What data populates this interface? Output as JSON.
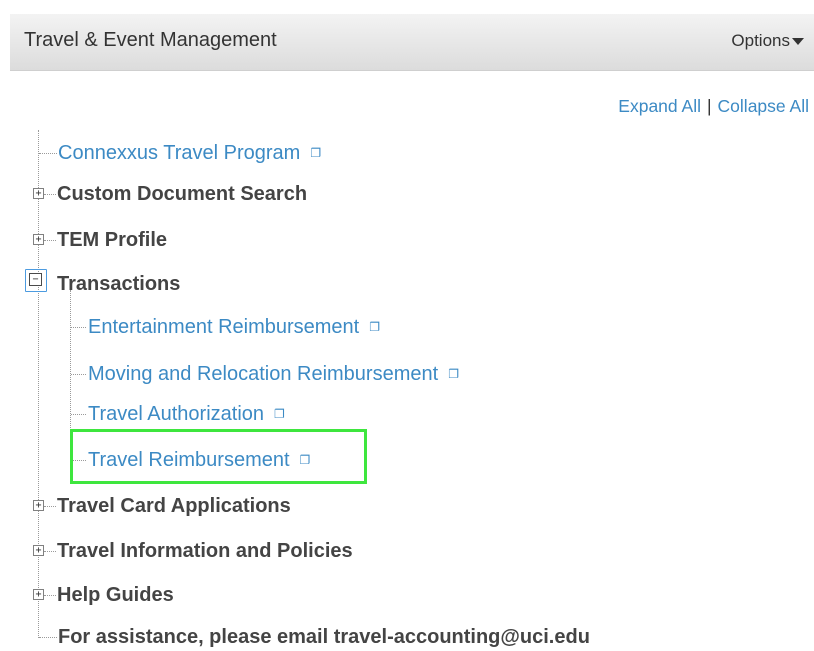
{
  "header": {
    "title": "Travel & Event Management",
    "options_label": "Options"
  },
  "expand_collapse": {
    "expand_label": "Expand All",
    "separator": "|",
    "collapse_label": "Collapse All"
  },
  "tree": {
    "connexxus": "Connexxus Travel Program",
    "custom_search": "Custom Document Search",
    "tem_profile": "TEM Profile",
    "transactions": {
      "label": "Transactions",
      "children": {
        "entertainment": "Entertainment Reimbursement",
        "moving": "Moving and Relocation Reimbursement",
        "travel_auth": "Travel Authorization",
        "travel_reimb": "Travel Reimbursement"
      }
    },
    "travel_card": "Travel Card Applications",
    "travel_info": "Travel Information and Policies",
    "help_guides": "Help Guides",
    "assistance": "For assistance, please email travel-accounting@uci.edu"
  },
  "icons": {
    "external_link": "external-link-icon",
    "expand": "plus-box-icon",
    "collapse": "minus-box-icon"
  },
  "colors": {
    "link": "#3c8ac4",
    "highlight": "#3ee63e",
    "bold_text": "#444444"
  }
}
